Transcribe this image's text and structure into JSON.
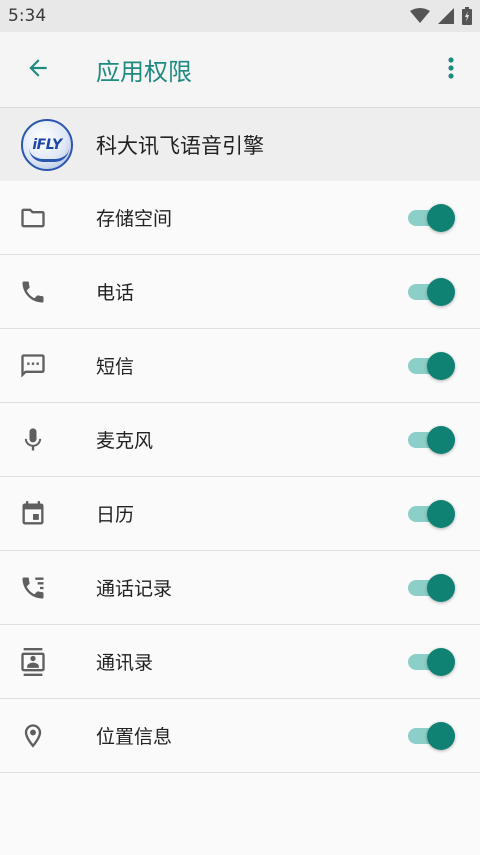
{
  "status_bar": {
    "time": "5:34"
  },
  "app_bar": {
    "title": "应用权限"
  },
  "app": {
    "logo_text": "iFLY",
    "name": "科大讯飞语音引擎"
  },
  "permissions": [
    {
      "label": "存储空间",
      "icon": "folder-icon",
      "enabled": true
    },
    {
      "label": "电话",
      "icon": "phone-icon",
      "enabled": true
    },
    {
      "label": "短信",
      "icon": "sms-icon",
      "enabled": true
    },
    {
      "label": "麦克风",
      "icon": "microphone-icon",
      "enabled": true
    },
    {
      "label": "日历",
      "icon": "calendar-icon",
      "enabled": true
    },
    {
      "label": "通话记录",
      "icon": "call-log-icon",
      "enabled": true
    },
    {
      "label": "通讯录",
      "icon": "contacts-icon",
      "enabled": true
    },
    {
      "label": "位置信息",
      "icon": "location-icon",
      "enabled": true
    }
  ],
  "colors": {
    "accent": "#1e8a80",
    "switch_thumb": "#0f8274",
    "switch_track": "#8ccfc8"
  }
}
